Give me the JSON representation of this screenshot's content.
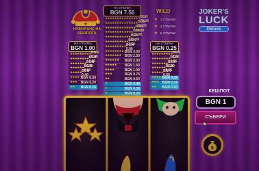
{
  "jackpot_caption": "НУЖНРАНЕ НА КЕШПОТА",
  "paytables": {
    "left": {
      "caption": "НА СТЪПКА",
      "value": "BGN 1.00",
      "rows": [
        {
          "stars": "★★★★★★★★★",
          "amount": "BGN 5.00"
        },
        {
          "stars": "★★★★★★★★",
          "amount": "BGN 1.00"
        },
        {
          "stars": "★★★★★★★",
          "amount": "BGN 0.75"
        },
        {
          "stars": "★★★★★★",
          "amount": "BGN 0.50"
        },
        {
          "stars": "★★★★★",
          "amount": "BGN 0.40"
        },
        {
          "stars": "★★★★",
          "amount": "BGN 0.30"
        },
        {
          "stars": "★★★",
          "amount": "BGN 0.20"
        },
        {
          "stars": "★★",
          "amount": "BGN 0.15"
        }
      ]
    },
    "center": {
      "caption": "НА СТЪПКА",
      "value": "BGN 7.50",
      "rows": [
        {
          "stars": "★★★★★★★★★★★★★★★",
          "amount": "BGN 75.00"
        },
        {
          "stars": "★★★★★★★★★★★★★★",
          "amount": "BGN 50.00"
        },
        {
          "stars": "★★★★★★★★★★★★★",
          "amount": "BGN 25.00"
        },
        {
          "stars": "★★★★★★★★★★★★",
          "amount": "BGN 15.00"
        },
        {
          "stars": "★★★★★★★★★★★",
          "amount": "BGN 10.00"
        },
        {
          "stars": "★★★★★★★★★★",
          "amount": "BGN 7.50"
        },
        {
          "stars": "★★★★★★★★★",
          "amount": "BGN 5.00"
        },
        {
          "stars": "★★★★★★★★",
          "amount": "BGN 3.00"
        },
        {
          "stars": "★★★★★★★",
          "amount": "BGN 2.50"
        },
        {
          "stars": "★★★★★★",
          "amount": "BGN 2.00"
        },
        {
          "stars": "★★★★★",
          "amount": "BGN 1.50"
        },
        {
          "stars": "★★★★",
          "amount": "BGN 1.00"
        },
        {
          "stars": "★★★",
          "amount": "BGN 0.75"
        },
        {
          "stars": "★★",
          "amount": "BGN 0.50"
        },
        {
          "stars": "★",
          "amount": "BGN 0.40"
        },
        {
          "stars": "★",
          "amount": "BGN 0.30"
        },
        {
          "stars": "★",
          "amount": "BGN 0.20"
        }
      ]
    },
    "right": {
      "caption": "НА СТЪПКА",
      "value": "BGN 0.25",
      "rows": [
        {
          "stars": "★★★★★★★★★",
          "amount": "BGN 2.50"
        },
        {
          "stars": "★★★★★★★★",
          "amount": "BGN 1.25"
        },
        {
          "stars": "★★★★★★★",
          "amount": "BGN 1.00"
        },
        {
          "stars": "★★★★★★",
          "amount": "BGN 0.75"
        },
        {
          "stars": "★★★★★",
          "amount": "BGN 0.50"
        },
        {
          "stars": "★★★★",
          "amount": "BGN 0.25"
        },
        {
          "stars": "★★★",
          "amount": "BGN 0.15"
        },
        {
          "stars": "★★",
          "amount": "BGN 0.10"
        }
      ]
    }
  },
  "wild": {
    "title": "WILD",
    "rows": [
      {
        "label": "2 СТЪПКИ"
      },
      {
        "label": "4 СТЪПКИ"
      },
      {
        "label": "8 СТЪПКИ"
      }
    ]
  },
  "logo": {
    "jokers": "JOKER'S",
    "luck": "LUCK",
    "deluxe": "Deluxe"
  },
  "jackpot_panel": {
    "label": "КЕШПОТ",
    "value": "BGN 1",
    "collect_label": "СЪБЕРИ"
  },
  "colors": {
    "gold": "#f1c232",
    "purple_bg": "#7b2596",
    "highlight_row": "#23b0d6",
    "collect_button": "#b7207c"
  }
}
